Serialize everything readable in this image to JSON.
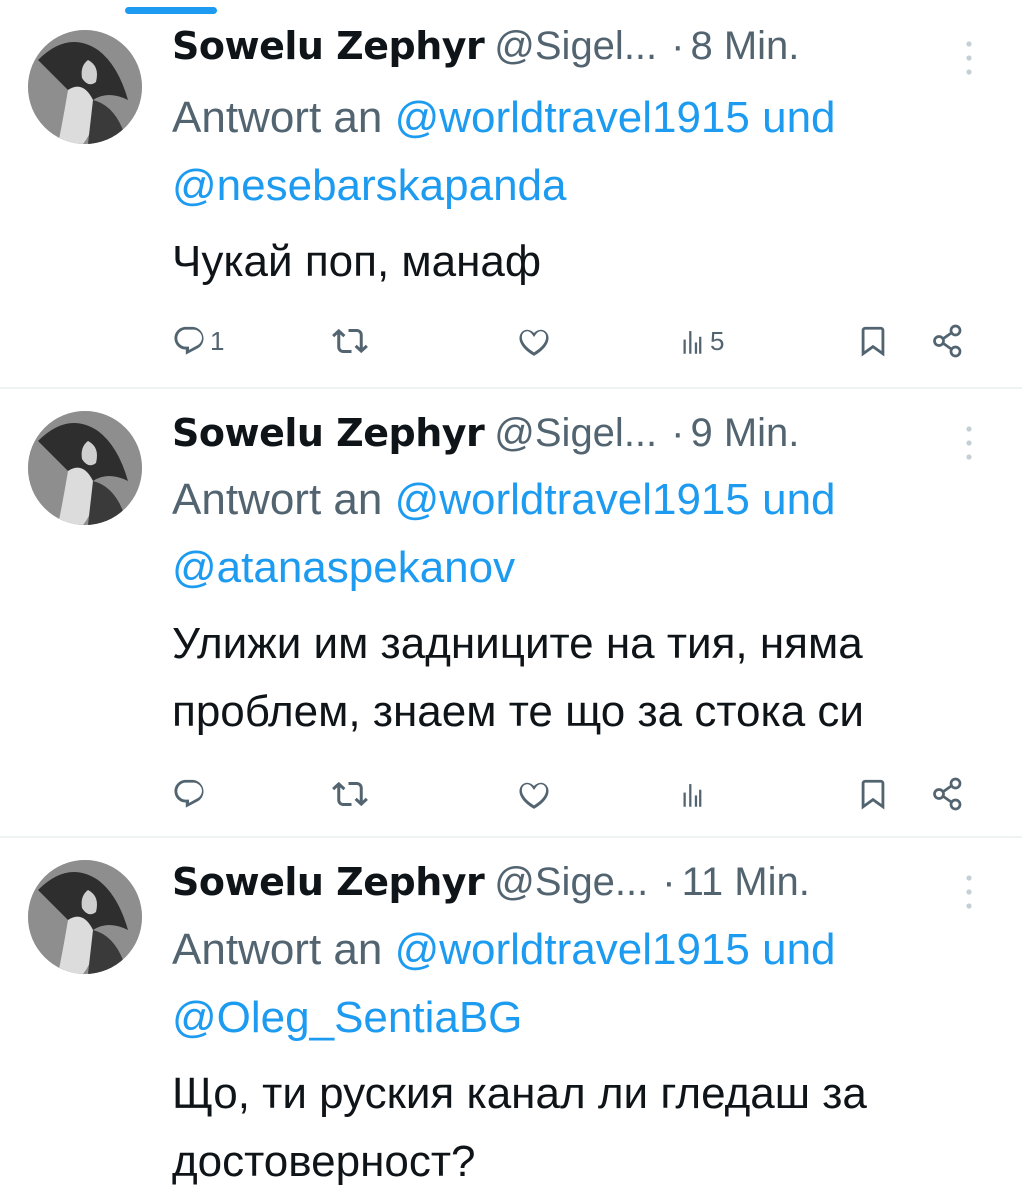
{
  "tweets": [
    {
      "author": {
        "name": "Sowelu Zephyr",
        "handle": "@Sigel...",
        "avatar_icon": "avatar-image"
      },
      "separator": "·",
      "time": "8 Min.",
      "reply": {
        "prefix": "Antwort an",
        "mention1": "@worldtravel1915",
        "conj": "und",
        "mention2": "@nesebarskapanda"
      },
      "text": "Чукай поп, манаф",
      "stats": {
        "replies": "1",
        "reposts": "",
        "likes": "",
        "views": "5"
      }
    },
    {
      "author": {
        "name": "Sowelu Zephyr",
        "handle": "@Sigel...",
        "avatar_icon": "avatar-image"
      },
      "separator": "·",
      "time": "9 Min.",
      "reply": {
        "prefix": "Antwort an",
        "mention1": "@worldtravel1915",
        "conj": "und",
        "mention2": "@atanaspekanov"
      },
      "text": "Улижи им задниците на тия, няма проблем, знаем те що за стока си",
      "stats": {
        "replies": "",
        "reposts": "",
        "likes": "",
        "views": ""
      }
    },
    {
      "author": {
        "name": "Sowelu Zephyr",
        "handle": "@Sige...",
        "avatar_icon": "avatar-image"
      },
      "separator": "·",
      "time": "11 Min.",
      "reply": {
        "prefix": "Antwort an",
        "mention1": "@worldtravel1915",
        "conj": "und",
        "mention2": "@Oleg_SentiaBG"
      },
      "text": "Що, ти руския канал ли гледаш за достоверност?",
      "stats": {
        "replies": "",
        "reposts": "",
        "likes": "",
        "views": ""
      }
    }
  ],
  "icons": {
    "reply": "reply-icon",
    "repost": "repost-icon",
    "like": "like-icon",
    "views": "views-icon",
    "bookmark": "bookmark-icon",
    "share": "share-icon",
    "more": "more-icon"
  },
  "colors": {
    "accent": "#1d9bf0",
    "secondary_text": "#536471",
    "primary_text": "#0f1419",
    "divider": "#eff3f4"
  }
}
